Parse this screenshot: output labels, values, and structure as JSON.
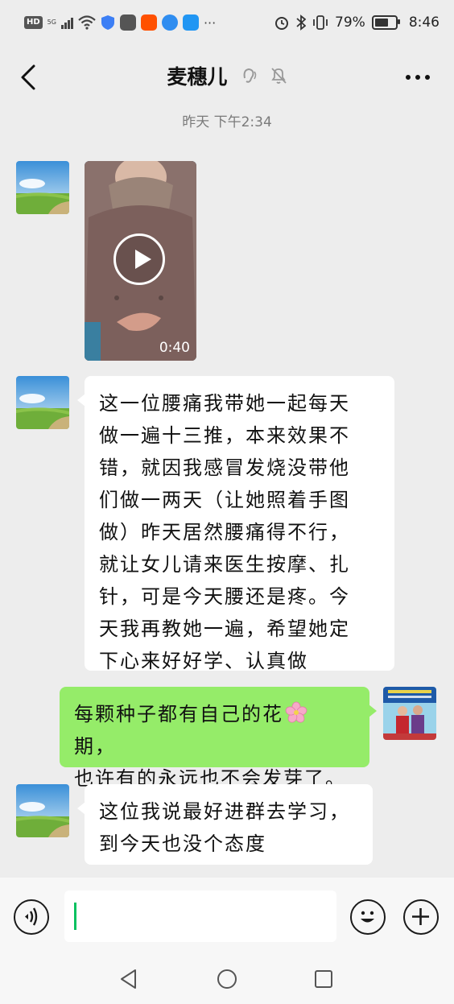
{
  "status_bar": {
    "hd": "HD",
    "network": "5G",
    "battery_text": "79%",
    "battery_level": 0.79,
    "time": "8:46"
  },
  "header": {
    "title": "麦穗儿",
    "back_icon": "chevron-left-icon",
    "more_icon": "more-dots-icon"
  },
  "chat": {
    "timestamp": "昨天 下午2:34",
    "video": {
      "duration": "0:40"
    },
    "messages": [
      {
        "lines": [
          "这一位腰痛我带她一起每天",
          "做一遍十三推，本来效果不",
          "错，就因我感冒发烧没带他",
          "们做一两天（让她照着手图",
          "做）昨天居然腰痛得不行，",
          "就让女儿请来医生按摩、扎",
          "针，可是今天腰还是疼。今",
          "天我再教她一遍，希望她定",
          "下心来好好学、认真做"
        ]
      },
      {
        "line1_before": "每颗种子都有自己的花",
        "line1_after": " 期，",
        "line2": "也许有的永远也不会发芽了。"
      },
      {
        "lines": [
          "这位我说最好进群去学习，",
          "到今天也没个态度"
        ]
      }
    ]
  },
  "input_bar": {
    "message_value": "",
    "voice_icon": "voice-icon",
    "emoji_icon": "emoji-icon",
    "plus_icon": "plus-icon"
  },
  "colors": {
    "background": "#ededed",
    "incoming_bubble": "#ffffff",
    "outgoing_bubble": "#95ec69",
    "cursor": "#07c160"
  }
}
